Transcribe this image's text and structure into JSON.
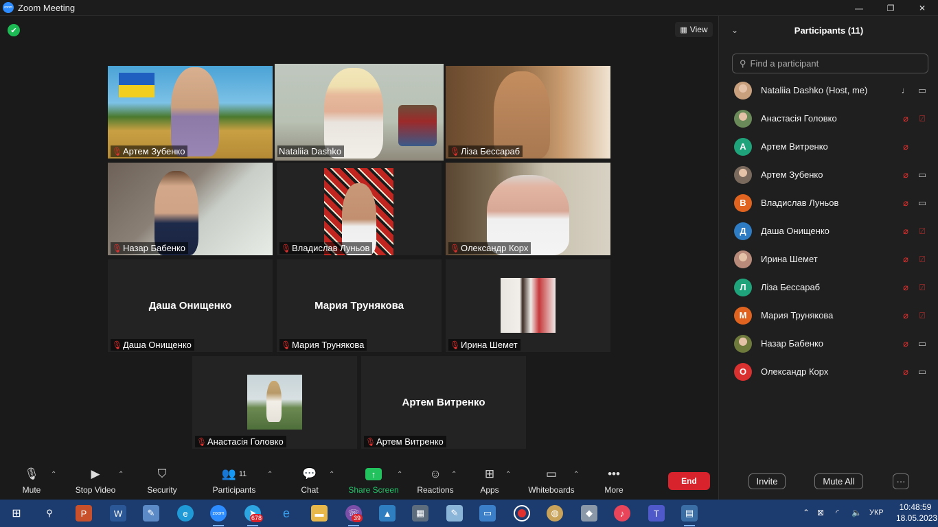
{
  "window": {
    "title": "Zoom Meeting",
    "app_icon": "zoom",
    "controls": [
      "—",
      "❐",
      "✕"
    ]
  },
  "meeting": {
    "view_label": "View",
    "tiles": [
      {
        "name": "Артем Зубенко",
        "video": true,
        "active": false
      },
      {
        "name": "Nataliia Dashko",
        "video": true,
        "active": true,
        "mic": "on"
      },
      {
        "name": "Ліза Бессараб",
        "video": true,
        "active": false
      },
      {
        "name": "Назар Бабенко",
        "video": true,
        "active": false
      },
      {
        "name": "Владислав Луньов",
        "video": true,
        "active": false
      },
      {
        "name": "Олександр Корх",
        "video": true,
        "active": false
      },
      {
        "name": "Даша Онищенко",
        "video": false,
        "display_name": "Даша Онищенко"
      },
      {
        "name": "Мария Трунякова",
        "video": false,
        "display_name": "Мария Трунякова"
      },
      {
        "name": "Ирина Шемет",
        "video": false,
        "photo": true
      },
      {
        "name": "Анастасія Головко",
        "video": false,
        "photo": true
      },
      {
        "name": "Артем Витренко",
        "video": false,
        "display_name": "Артем Витренко"
      }
    ]
  },
  "toolbar": {
    "mute": "Mute",
    "stop_video": "Stop Video",
    "security": "Security",
    "participants": "Participants",
    "participants_count": "11",
    "chat": "Chat",
    "share_screen": "Share Screen",
    "reactions": "Reactions",
    "apps": "Apps",
    "whiteboards": "Whiteboards",
    "more": "More",
    "end": "End"
  },
  "panel": {
    "title": "Participants (11)",
    "search_placeholder": "Find a participant",
    "invite": "Invite",
    "mute_all": "Mute All",
    "more": "···",
    "participants": [
      {
        "name": "Nataliia Dashko (Host, me)",
        "avatar": "photo",
        "color": "#c9a07d",
        "mic": "on",
        "cam": "on"
      },
      {
        "name": "Анастасія Головко",
        "avatar": "photo",
        "color": "#6b8a5a",
        "mic": "off",
        "cam": "off"
      },
      {
        "name": "Артем Витренко",
        "avatar": "А",
        "color": "#1fa37a",
        "mic": "off",
        "cam": "none"
      },
      {
        "name": "Артем Зубенко",
        "avatar": "photo",
        "color": "#7a6a5e",
        "mic": "off",
        "cam": "on"
      },
      {
        "name": "Владислав Луньов",
        "avatar": "В",
        "color": "#e0641f",
        "mic": "off",
        "cam": "on"
      },
      {
        "name": "Даша Онищенко",
        "avatar": "Д",
        "color": "#2d7cc4",
        "mic": "off",
        "cam": "off"
      },
      {
        "name": "Ирина Шемет",
        "avatar": "photo",
        "color": "#b88a7a",
        "mic": "off",
        "cam": "off"
      },
      {
        "name": "Ліза Бессараб",
        "avatar": "Л",
        "color": "#1fa37a",
        "mic": "off",
        "cam": "off"
      },
      {
        "name": "Мария Трунякова",
        "avatar": "М",
        "color": "#e0641f",
        "mic": "off",
        "cam": "off"
      },
      {
        "name": "Назар Бабенко",
        "avatar": "photo",
        "color": "#6d7a3c",
        "mic": "off",
        "cam": "on"
      },
      {
        "name": "Олександр Корх",
        "avatar": "О",
        "color": "#d93030",
        "mic": "off",
        "cam": "on"
      }
    ]
  },
  "taskbar": {
    "badges": {
      "telegram": "678",
      "viber": "39"
    },
    "language": "УКР",
    "time": "10:48:59",
    "date": "18.05.2023"
  }
}
